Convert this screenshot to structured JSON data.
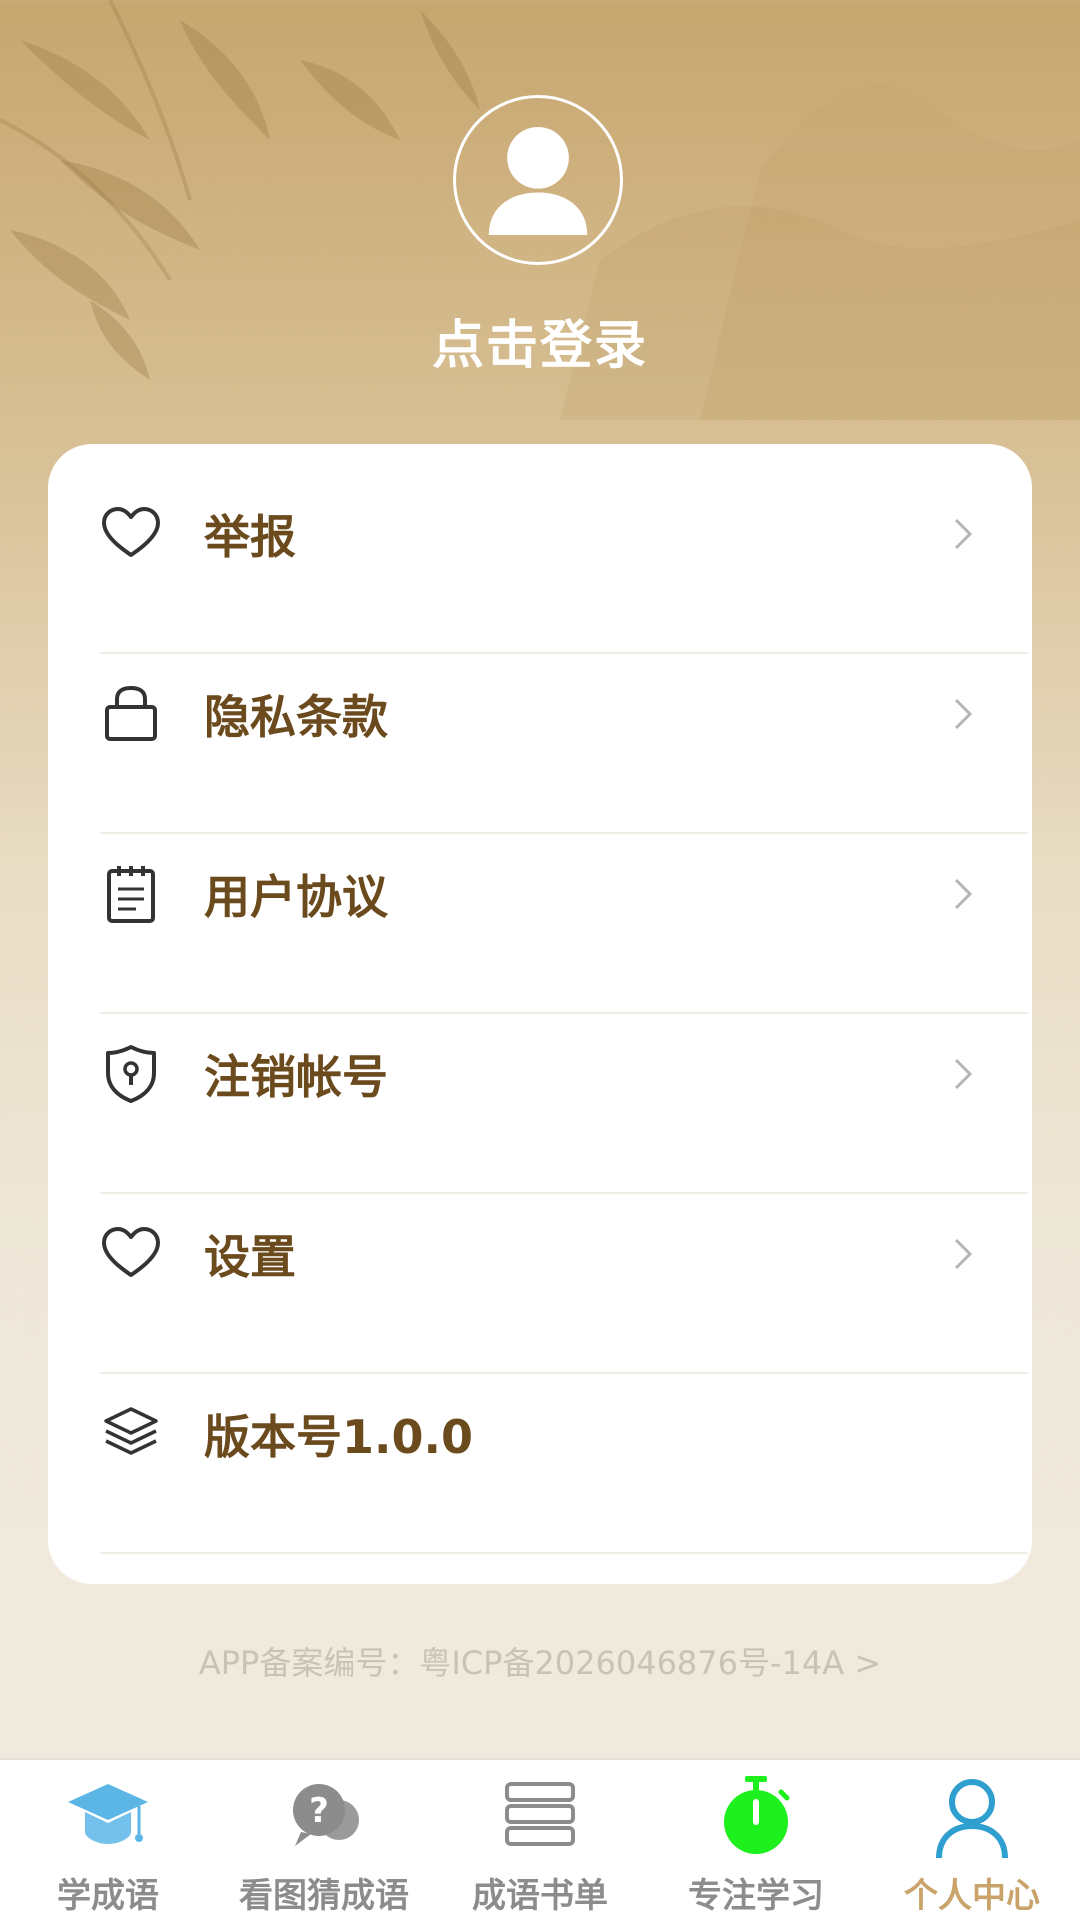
{
  "header": {
    "login_text": "点击登录"
  },
  "menu": {
    "items": [
      {
        "label": "举报",
        "icon": "heart-icon",
        "chevron": true
      },
      {
        "label": "隐私条款",
        "icon": "lock-icon",
        "chevron": true
      },
      {
        "label": "用户协议",
        "icon": "notepad-icon",
        "chevron": true
      },
      {
        "label": "注销帐号",
        "icon": "shield-keyhole-icon",
        "chevron": true
      },
      {
        "label": "设置",
        "icon": "heart-icon",
        "chevron": true
      },
      {
        "label": "版本号1.0.0",
        "icon": "layers-icon",
        "chevron": false
      }
    ]
  },
  "footer": {
    "icp": "APP备案编号：粤ICP备2026046876号-14A >"
  },
  "tabbar": {
    "active_index": 4,
    "tabs": [
      {
        "label": "学成语",
        "icon": "graduation-cap-icon"
      },
      {
        "label": "看图猜成语",
        "icon": "question-chat-icon"
      },
      {
        "label": "成语书单",
        "icon": "book-stack-icon"
      },
      {
        "label": "专注学习",
        "icon": "stopwatch-icon"
      },
      {
        "label": "个人中心",
        "icon": "user-icon"
      }
    ]
  },
  "colors": {
    "menu_text": "#6b4a1e",
    "active_tab": "#c9a36a",
    "inactive_tab": "#8c8c8c",
    "stopwatch": "#1ef01e",
    "cap": "#5bb6e6",
    "user_icon": "#2f9fd0"
  }
}
